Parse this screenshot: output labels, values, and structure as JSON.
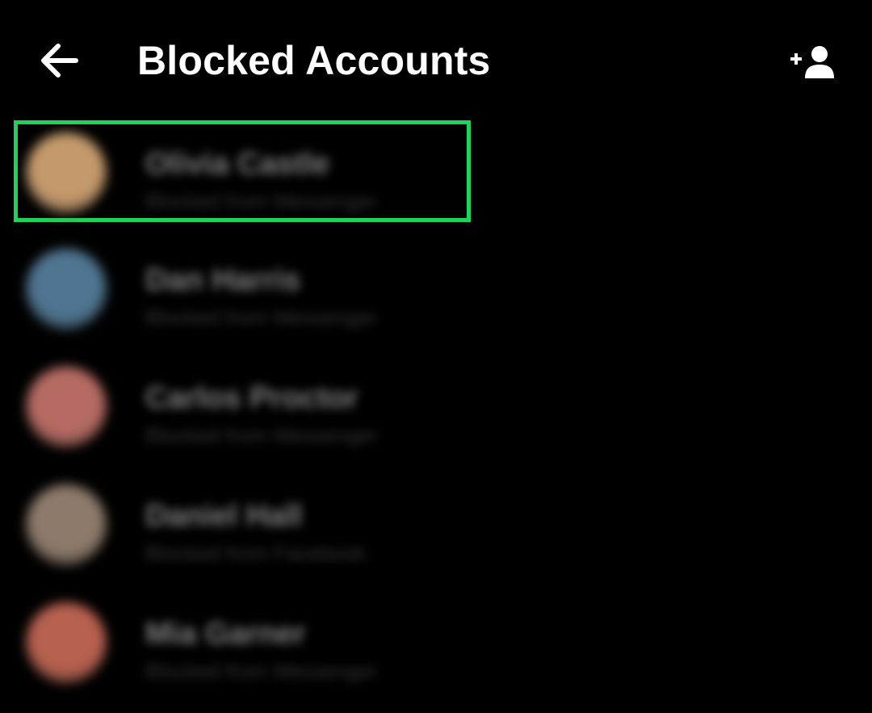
{
  "header": {
    "back_icon": "arrow-left-icon",
    "title": "Blocked Accounts",
    "add_icon": "add-person-icon"
  },
  "colors": {
    "background": "#000000",
    "highlight": "#1fd35a",
    "text": "#ffffff"
  },
  "blocked_accounts": [
    {
      "name": "Olivia Castle",
      "subtitle": "Blocked from Messenger",
      "avatar_color": "#c49a6c",
      "highlighted": true
    },
    {
      "name": "Dan Harris",
      "subtitle": "Blocked from Messenger",
      "avatar_color": "#4f7590",
      "highlighted": false
    },
    {
      "name": "Carlos Proctor",
      "subtitle": "Blocked from Messenger",
      "avatar_color": "#b56b62",
      "highlighted": false
    },
    {
      "name": "Daniel Hall",
      "subtitle": "Blocked from Facebook",
      "avatar_color": "#8d7a6a",
      "highlighted": false
    },
    {
      "name": "Mia Garner",
      "subtitle": "Blocked from Messenger",
      "avatar_color": "#b7614f",
      "highlighted": false
    }
  ]
}
